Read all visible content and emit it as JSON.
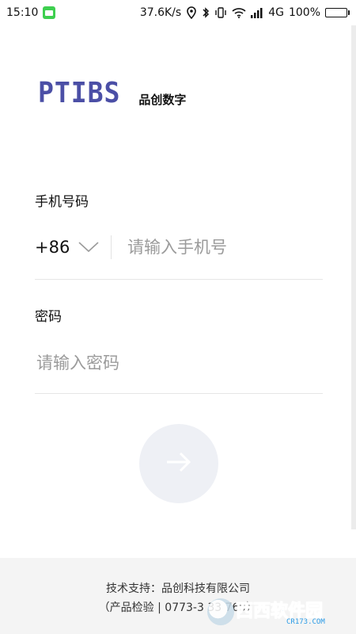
{
  "status_bar": {
    "time": "15:10",
    "network_speed": "37.6K/s",
    "network_type": "4G",
    "battery_percent": "100%",
    "battery_level": 1.0,
    "icons": [
      "app-icon",
      "location-icon",
      "bluetooth-icon",
      "vibrate-icon",
      "wifi-icon",
      "signal-icon",
      "battery-icon"
    ]
  },
  "brand": {
    "logo_mark": "PTIBS",
    "name": "品创数字",
    "color": "#4b4fa6"
  },
  "form": {
    "phone_label": "手机号码",
    "country_code": "+86",
    "phone_placeholder": "请输入手机号",
    "password_label": "密码",
    "password_placeholder": "请输入密码",
    "submit_icon": "arrow-right-icon"
  },
  "footer": {
    "support_text": "技术支持：品创科技有限公司",
    "support_detail": "（产品检验 | 0773-3 33 769）"
  },
  "watermark": {
    "text": "西西软件园",
    "sub": "CR173.COM"
  }
}
